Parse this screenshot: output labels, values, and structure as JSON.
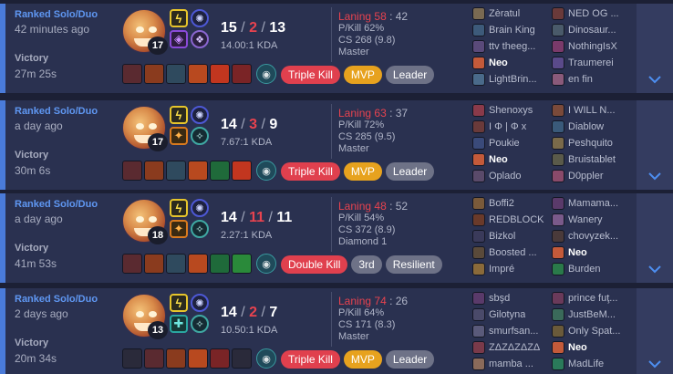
{
  "colors": {
    "page_bg": "#1c2035",
    "row_bg": "#2a3150",
    "accent": "#4a7bd9",
    "queue_blue": "#5f97f2",
    "death_red": "#e8434f",
    "tag_red": "#e0404e",
    "tag_gold": "#e7a21e",
    "tag_grey": "#6e7287"
  },
  "matches": [
    {
      "queue": "Ranked Solo/Duo",
      "ago": "42 minutes ago",
      "result": "Victory",
      "duration": "27m 25s",
      "champion_level": "17",
      "spells": [
        "flash-icon",
        "teleport-icon"
      ],
      "runes": [
        "primary-rune-icon",
        "inspiration-rune-icon"
      ],
      "kills": "15",
      "deaths": "2",
      "assists": "13",
      "kda_ratio": "14.00:1 KDA",
      "items": [
        "#5a2a30",
        "#8a3b1e",
        "#2f4a5e",
        "#b8491f",
        "#c2361f",
        "#7a2426"
      ],
      "tags": [
        {
          "label": "Triple Kill",
          "style": "red"
        },
        {
          "label": "MVP",
          "style": "gold"
        },
        {
          "label": "Leader",
          "style": "grey"
        }
      ],
      "laning_label": "Laning",
      "laning": "58",
      "laning_opp": ": 42",
      "pkill": "P/Kill 62%",
      "cs": "CS 268 (9.8)",
      "rank": "Master",
      "team_blue": [
        {
          "name": "Zèratul",
          "color": "#7a6a52",
          "me": false
        },
        {
          "name": "Brain King",
          "color": "#3d5a7a",
          "me": false
        },
        {
          "name": "ttv theeg...",
          "color": "#5a4a7a",
          "me": false
        },
        {
          "name": "Neo",
          "color": "#c35a3a",
          "me": true
        },
        {
          "name": "LightBrin...",
          "color": "#4a6a8a",
          "me": false
        }
      ],
      "team_red": [
        {
          "name": "NED OG ...",
          "color": "#6a3a3a",
          "me": false
        },
        {
          "name": "Dinosaur...",
          "color": "#4a5a6a",
          "me": false
        },
        {
          "name": "NothingIsX",
          "color": "#7a3a6a",
          "me": false
        },
        {
          "name": "Traumerei",
          "color": "#5a4a8a",
          "me": false
        },
        {
          "name": "en fin",
          "color": "#8a5a7a",
          "me": false
        }
      ]
    },
    {
      "queue": "Ranked Solo/Duo",
      "ago": "a day ago",
      "result": "Victory",
      "duration": "30m 6s",
      "champion_level": "17",
      "spells": [
        "flash-icon",
        "ignite-icon"
      ],
      "runes": [
        "primary-rune-icon",
        "secondary-rune-icon"
      ],
      "kills": "14",
      "deaths": "3",
      "assists": "9",
      "kda_ratio": "7.67:1 KDA",
      "items": [
        "#5a2a30",
        "#8a3b1e",
        "#2f4a5e",
        "#b8491f",
        "#1f6a3a",
        "#c2361f"
      ],
      "tags": [
        {
          "label": "Triple Kill",
          "style": "red"
        },
        {
          "label": "MVP",
          "style": "gold"
        },
        {
          "label": "Leader",
          "style": "grey"
        }
      ],
      "laning_label": "Laning",
      "laning": "63",
      "laning_opp": ": 37",
      "pkill": "P/Kill 72%",
      "cs": "CS 285 (9.5)",
      "rank": "Master",
      "team_blue": [
        {
          "name": "Shenoxys",
          "color": "#8a3a4a",
          "me": false
        },
        {
          "name": "I Φ | Φ x",
          "color": "#6a3a3a",
          "me": false
        },
        {
          "name": "Poukie",
          "color": "#3a4a7a",
          "me": false
        },
        {
          "name": "Neo",
          "color": "#c35a3a",
          "me": true
        },
        {
          "name": "Oplado",
          "color": "#5a4a6a",
          "me": false
        }
      ],
      "team_red": [
        {
          "name": "I WILL N...",
          "color": "#7a4a3a",
          "me": false
        },
        {
          "name": "Diablow",
          "color": "#3a5a7a",
          "me": false
        },
        {
          "name": "Peshquito",
          "color": "#7a6a4a",
          "me": false
        },
        {
          "name": "Bruistablet",
          "color": "#5a5a4a",
          "me": false
        },
        {
          "name": "D0ppler",
          "color": "#8a4a6a",
          "me": false
        }
      ]
    },
    {
      "queue": "Ranked Solo/Duo",
      "ago": "a day ago",
      "result": "Victory",
      "duration": "41m 53s",
      "champion_level": "18",
      "spells": [
        "flash-icon",
        "ignite-icon"
      ],
      "runes": [
        "primary-rune-icon",
        "secondary-rune-icon"
      ],
      "kills": "14",
      "deaths": "11",
      "assists": "11",
      "kda_ratio": "2.27:1 KDA",
      "items": [
        "#5a2a30",
        "#8a3b1e",
        "#2f4a5e",
        "#b8491f",
        "#1f6a3a",
        "#2a8a3a"
      ],
      "tags": [
        {
          "label": "Double Kill",
          "style": "red"
        },
        {
          "label": "3rd",
          "style": "grey"
        },
        {
          "label": "Resilient",
          "style": "grey"
        }
      ],
      "laning_label": "Laning",
      "laning": "48",
      "laning_opp": ": 52",
      "pkill": "P/Kill 54%",
      "cs": "CS 372 (8.9)",
      "rank": "Diamond 1",
      "team_blue": [
        {
          "name": "Boffi2",
          "color": "#7a5a3a",
          "me": false
        },
        {
          "name": "REDBLOCK",
          "color": "#6a3a2a",
          "me": false
        },
        {
          "name": "Bizkol",
          "color": "#3a3a5a",
          "me": false
        },
        {
          "name": "Boosted ...",
          "color": "#5a4a3a",
          "me": false
        },
        {
          "name": "Impré",
          "color": "#8a6a3a",
          "me": false
        }
      ],
      "team_red": [
        {
          "name": "Mamama...",
          "color": "#5a3a6a",
          "me": false
        },
        {
          "name": "Wanery",
          "color": "#7a5a8a",
          "me": false
        },
        {
          "name": "chovyzek...",
          "color": "#4a3a3a",
          "me": false
        },
        {
          "name": "Neo",
          "color": "#c35a3a",
          "me": true
        },
        {
          "name": "Burden",
          "color": "#2a7a4a",
          "me": false
        }
      ]
    },
    {
      "queue": "Ranked Solo/Duo",
      "ago": "2 days ago",
      "result": "Victory",
      "duration": "20m 34s",
      "champion_level": "13",
      "spells": [
        "flash-icon",
        "cleanse-icon"
      ],
      "runes": [
        "primary-rune-icon",
        "secondary-rune-icon"
      ],
      "kills": "14",
      "deaths": "2",
      "assists": "7",
      "kda_ratio": "10.50:1 KDA",
      "items": [
        "#2a2a3a",
        "#5a2a30",
        "#8a3b1e",
        "#b8491f",
        "#7a2426",
        "#2a2a3a"
      ],
      "tags": [
        {
          "label": "Triple Kill",
          "style": "red"
        },
        {
          "label": "MVP",
          "style": "gold"
        },
        {
          "label": "Leader",
          "style": "grey"
        }
      ],
      "laning_label": "Laning",
      "laning": "74",
      "laning_opp": ": 26",
      "pkill": "P/Kill 64%",
      "cs": "CS 171 (8.3)",
      "rank": "Master",
      "team_blue": [
        {
          "name": "sbşd",
          "color": "#5a3a6a",
          "me": false
        },
        {
          "name": "Gilotyna",
          "color": "#4a4a6a",
          "me": false
        },
        {
          "name": "smurfsan...",
          "color": "#5a5a7a",
          "me": false
        },
        {
          "name": "ZΔZΔZΔZΔ",
          "color": "#7a3a4a",
          "me": false
        },
        {
          "name": "mamba ...",
          "color": "#8a6a5a",
          "me": false
        }
      ],
      "team_red": [
        {
          "name": "prince fuţ...",
          "color": "#6a3a5a",
          "me": false
        },
        {
          "name": "JustBeM...",
          "color": "#3a6a5a",
          "me": false
        },
        {
          "name": "Only Spat...",
          "color": "#6a5a3a",
          "me": false
        },
        {
          "name": "Neo",
          "color": "#c35a3a",
          "me": true
        },
        {
          "name": "MadLife",
          "color": "#2a7a5a",
          "me": false
        }
      ]
    }
  ]
}
